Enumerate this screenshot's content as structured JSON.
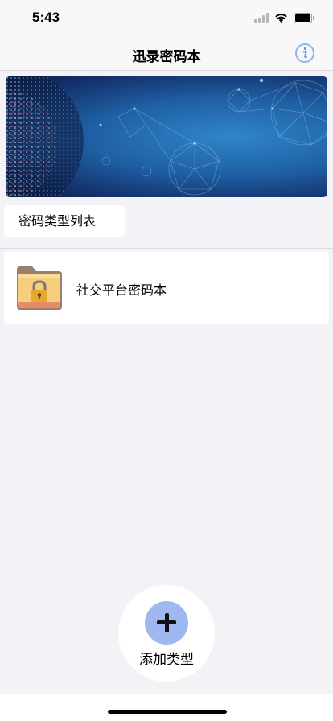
{
  "status": {
    "time": "5:43"
  },
  "nav": {
    "title": "迅录密码本",
    "info_icon": "info-icon"
  },
  "banner": {
    "image": "digital-globe-banner"
  },
  "section": {
    "title": "密码类型列表"
  },
  "list": {
    "items": [
      {
        "label": "社交平台密码本",
        "icon": "locked-folder-icon"
      }
    ]
  },
  "add_button": {
    "label": "添加类型",
    "icon": "plus-icon"
  },
  "colors": {
    "accent": "#9fb8ef",
    "info": "#5b9be0",
    "background": "#f2f2f7"
  }
}
